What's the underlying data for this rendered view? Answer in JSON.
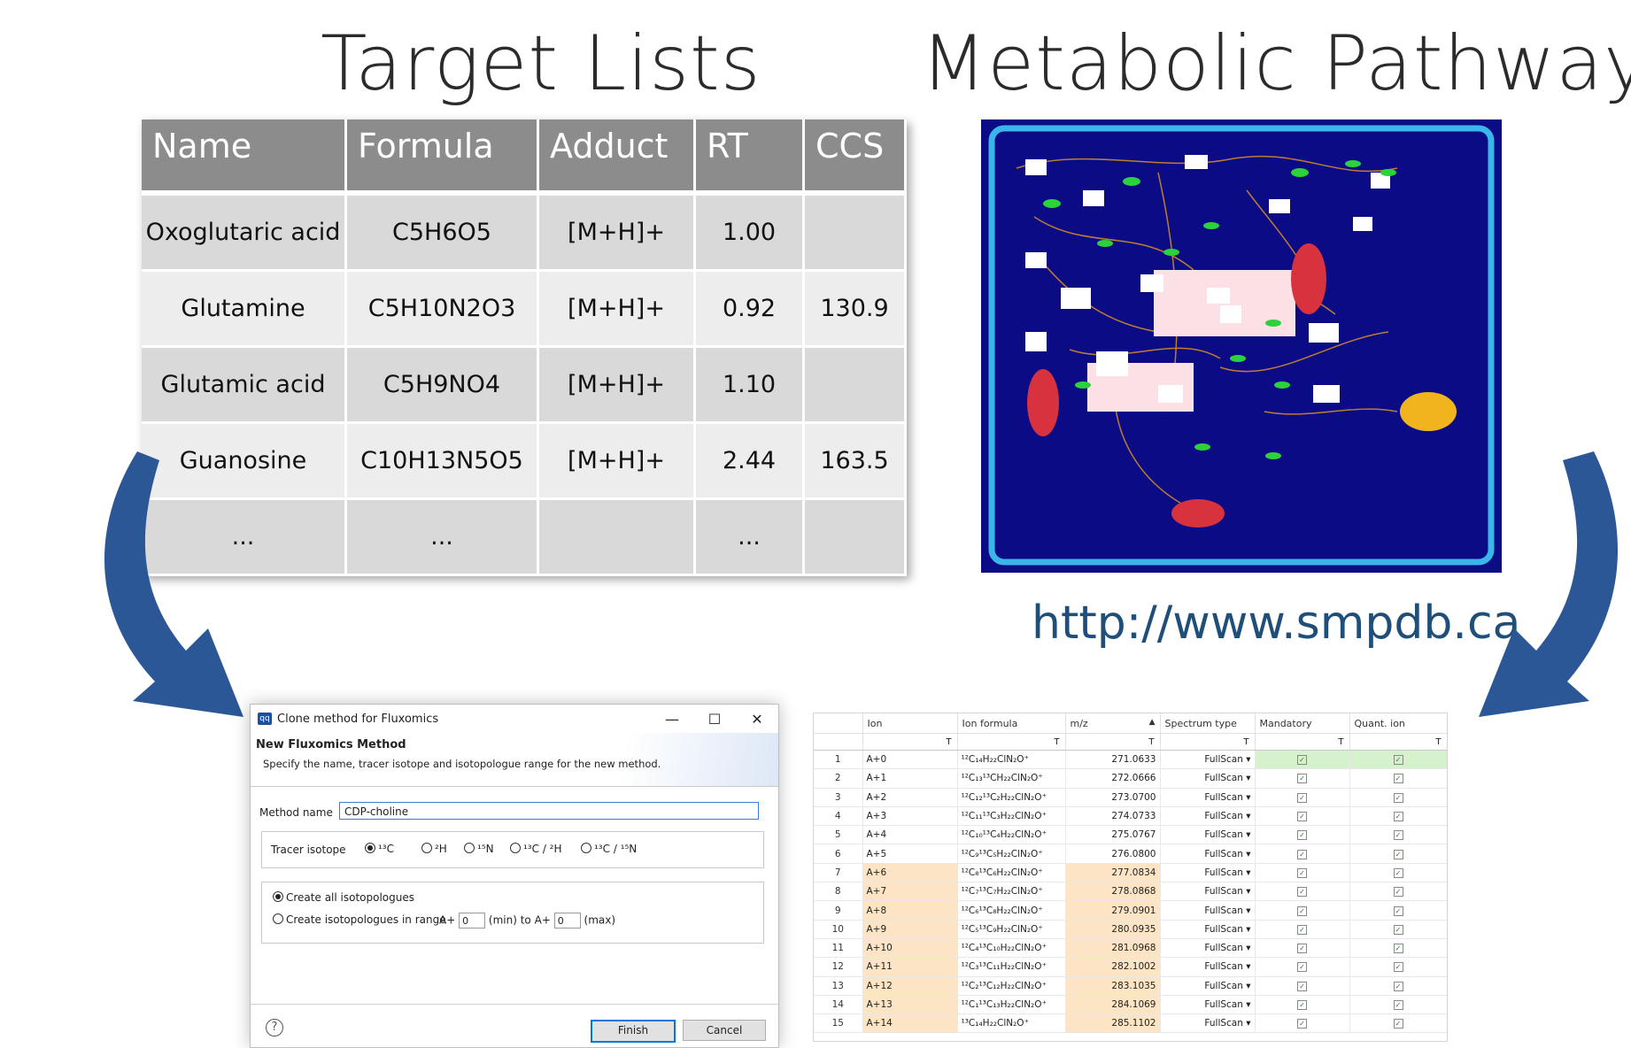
{
  "headings": {
    "target_lists": "Target Lists",
    "metabolic_pathways": "Metabolic Pathways",
    "url": "http://www.smpdb.ca"
  },
  "target_table": {
    "columns": [
      "Name",
      "Formula",
      "Adduct",
      "RT",
      "CCS"
    ],
    "rows": [
      [
        "Oxoglutaric acid",
        "C5H6O5",
        "[M+H]+",
        "1.00",
        ""
      ],
      [
        "Glutamine",
        "C5H10N2O3",
        "[M+H]+",
        "0.92",
        "130.9"
      ],
      [
        "Glutamic acid",
        "C5H9NO4",
        "[M+H]+",
        "1.10",
        ""
      ],
      [
        "Guanosine",
        "C10H13N5O5",
        "[M+H]+",
        "2.44",
        "163.5"
      ],
      [
        "...",
        "...",
        "",
        "...",
        ""
      ]
    ]
  },
  "dialog": {
    "app_icon": "qq",
    "title": "Clone method for Fluxomics",
    "win_minimize": "—",
    "win_maximize": "☐",
    "win_close": "✕",
    "heading": "New Fluxomics Method",
    "subtitle": "Specify the name, tracer isotope and isotopologue range for the new method.",
    "method_name_label": "Method name",
    "method_name_value": "CDP-choline",
    "tracer_label": "Tracer isotope",
    "tracer_options": [
      "¹³C",
      "²H",
      "¹⁵N",
      "¹³C / ²H",
      "¹³C / ¹⁵N"
    ],
    "create_all_label": "Create all isotopologues",
    "create_range_label": "Create isotopologues in range",
    "range_prefix": "A+",
    "range_min_value": "0",
    "range_min_label": "(min) to",
    "range_max_value": "0",
    "range_max_label": "(max)",
    "help_label": "?",
    "finish_label": "Finish",
    "cancel_label": "Cancel"
  },
  "ion_grid": {
    "columns": [
      "",
      "Ion",
      "Ion formula",
      "m/z",
      "Spectrum type",
      "Mandatory",
      "Quant. ion"
    ],
    "sort_indicator": "▲",
    "filter_glyph": "T",
    "check_glyph": "✓",
    "rows": [
      [
        "1",
        "A+0",
        "¹²C₁₄H₂₂ClN₂O⁺",
        "271.0633",
        "FullScan ▾"
      ],
      [
        "2",
        "A+1",
        "¹²C₁₃¹³CH₂₂ClN₂O⁺",
        "272.0666",
        "FullScan ▾"
      ],
      [
        "3",
        "A+2",
        "¹²C₁₂¹³C₂H₂₂ClN₂O⁺",
        "273.0700",
        "FullScan ▾"
      ],
      [
        "4",
        "A+3",
        "¹²C₁₁¹³C₃H₂₂ClN₂O⁺",
        "274.0733",
        "FullScan ▾"
      ],
      [
        "5",
        "A+4",
        "¹²C₁₀¹³C₄H₂₂ClN₂O⁺",
        "275.0767",
        "FullScan ▾"
      ],
      [
        "6",
        "A+5",
        "¹²C₉¹³C₅H₂₂ClN₂O⁺",
        "276.0800",
        "FullScan ▾"
      ],
      [
        "7",
        "A+6",
        "¹²C₈¹³C₆H₂₂ClN₂O⁺",
        "277.0834",
        "FullScan ▾"
      ],
      [
        "8",
        "A+7",
        "¹²C₇¹³C₇H₂₂ClN₂O⁺",
        "278.0868",
        "FullScan ▾"
      ],
      [
        "9",
        "A+8",
        "¹²C₆¹³C₈H₂₂ClN₂O⁺",
        "279.0901",
        "FullScan ▾"
      ],
      [
        "10",
        "A+9",
        "¹²C₅¹³C₉H₂₂ClN₂O⁺",
        "280.0935",
        "FullScan ▾"
      ],
      [
        "11",
        "A+10",
        "¹²C₄¹³C₁₀H₂₂ClN₂O⁺",
        "281.0968",
        "FullScan ▾"
      ],
      [
        "12",
        "A+11",
        "¹²C₃¹³C₁₁H₂₂ClN₂O⁺",
        "282.1002",
        "FullScan ▾"
      ],
      [
        "13",
        "A+12",
        "¹²C₂¹³C₁₂H₂₂ClN₂O⁺",
        "283.1035",
        "FullScan ▾"
      ],
      [
        "14",
        "A+13",
        "¹²C₁¹³C₁₃H₂₂ClN₂O⁺",
        "284.1069",
        "FullScan ▾"
      ],
      [
        "15",
        "A+14",
        "¹³C₁₄H₂₂ClN₂O⁺",
        "285.1102",
        "FullScan ▾"
      ]
    ]
  },
  "colors": {
    "arrow": "#2b5797",
    "pathway_bg": "#0b0b85",
    "highlight": "#fce4c4",
    "selected": "#d6f2cc"
  }
}
